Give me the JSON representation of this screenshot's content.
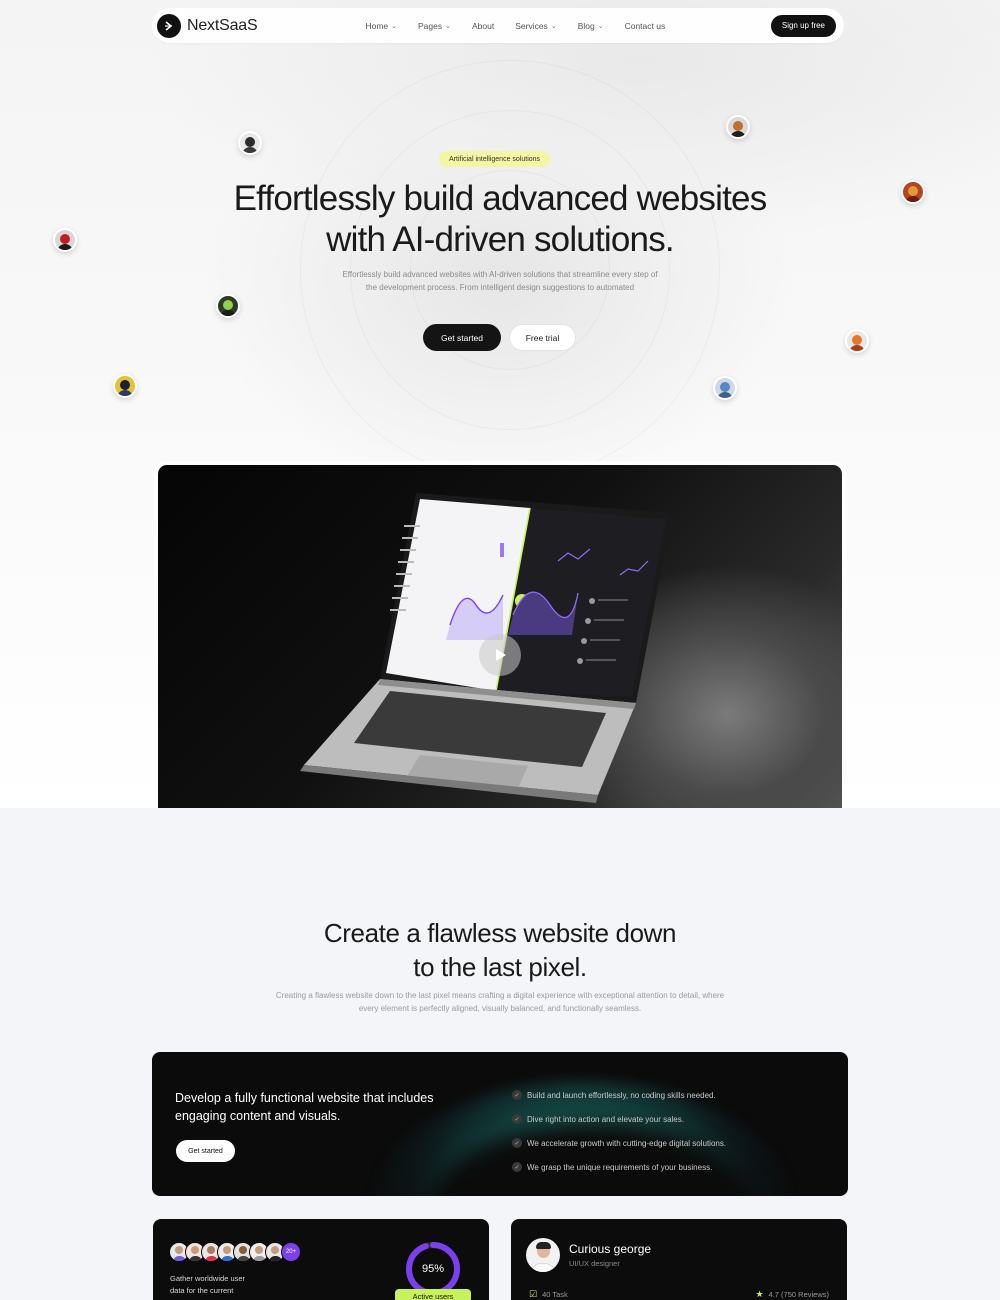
{
  "nav": {
    "brand": "NextSaaS",
    "items": [
      {
        "label": "Home",
        "dropdown": true
      },
      {
        "label": "Pages",
        "dropdown": true
      },
      {
        "label": "About",
        "dropdown": false
      },
      {
        "label": "Services",
        "dropdown": true
      },
      {
        "label": "Blog",
        "dropdown": true
      },
      {
        "label": "Contact us",
        "dropdown": false
      }
    ],
    "cta": "Sign up free"
  },
  "hero": {
    "tag": "Artificial intelligence solutions",
    "title_line1": "Effortlessly build advanced websites",
    "title_line2": "with AI-driven solutions.",
    "subtitle_line1": "Effortlessly build advanced websites with AI-driven solutions that streamline every step of",
    "subtitle_line2": "the development process. From intelligent design suggestions to automated",
    "primary_button": "Get started",
    "secondary_button": "Free trial"
  },
  "features": {
    "title_line1": "Create a flawless website down",
    "title_line2": "to the last pixel.",
    "subtitle_line1": "Creating a flawless website down to the last pixel means crafting a digital experience with exceptional attention to detail, where",
    "subtitle_line2": "every element is perfectly aligned, visually balanced, and functionally seamless.",
    "card": {
      "heading_line1": "Develop a fully functional website that includes",
      "heading_line2": "engaging content and visuals.",
      "button": "Get started",
      "checklist": [
        "Build and launch effortlessly, no coding skills needed.",
        "Dive right into action and elevate your sales.",
        "We accelerate growth with cutting-edge digital solutions.",
        "We grasp the unique requirements of your business."
      ]
    }
  },
  "stats": {
    "more_count": "20+",
    "text_line1": "Gather worldwide user",
    "text_line2": "data for the current",
    "percent_label": "95%",
    "percent_value": 95,
    "badge": "Active users"
  },
  "profile": {
    "name": "Curious george",
    "role": "UI/UX designer",
    "tasks": "40 Task",
    "rating": "4.7 (750 Reviews)"
  },
  "colors": {
    "accent_lime": "#c8f25c",
    "accent_purple": "#7b3ff0",
    "tag_yellow": "#f3f6a3",
    "dark": "#111111"
  }
}
